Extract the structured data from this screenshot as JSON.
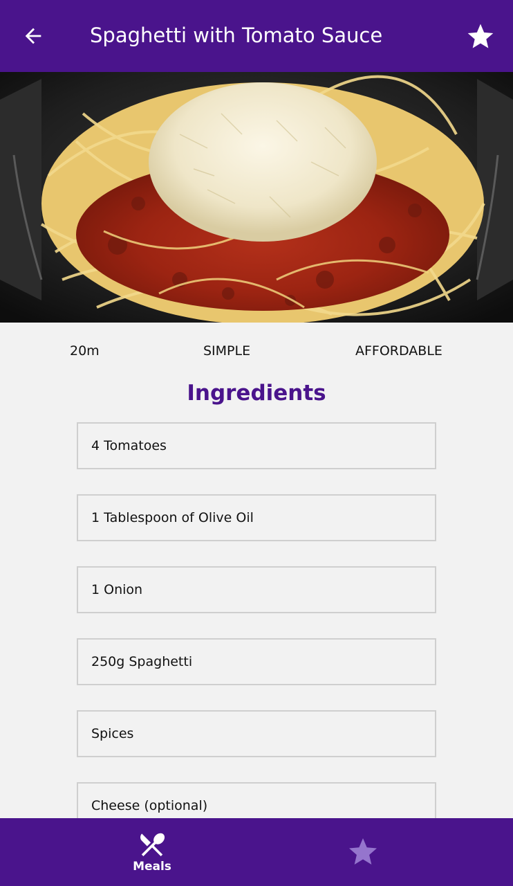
{
  "appbar": {
    "title": "Spaghetti with Tomato Sauce",
    "back_icon": "arrow-left-icon",
    "favorite_icon": "star-icon"
  },
  "meta": {
    "duration": "20m",
    "complexity": "SIMPLE",
    "affordability": "AFFORDABLE"
  },
  "ingredients": {
    "title": "Ingredients",
    "items": [
      "4 Tomatoes",
      "1 Tablespoon of Olive Oil",
      "1 Onion",
      "250g Spaghetti",
      "Spices",
      "Cheese (optional)"
    ]
  },
  "bottom_nav": {
    "meals_label": "Meals",
    "meals_icon": "fork-knife-icon",
    "favorites_icon": "star-icon"
  },
  "colors": {
    "primary": "#4a148c",
    "background": "#f2f2f2",
    "inactive_icon": "#9575cd"
  }
}
